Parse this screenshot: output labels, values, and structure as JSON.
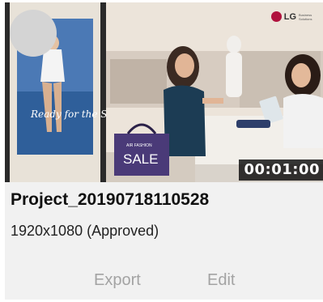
{
  "project": {
    "name": "Project_20190718110528",
    "resolution_status": "1920x1080 (Approved)",
    "duration": "00:01:00"
  },
  "thumbnail": {
    "brand": "LG",
    "brand_sub": "Business Solutions",
    "poster_text": "Ready for the Summer!",
    "bag_text_small": "AIR FASHION",
    "bag_text": "SALE"
  },
  "actions": {
    "export_label": "Export",
    "edit_label": "Edit"
  }
}
